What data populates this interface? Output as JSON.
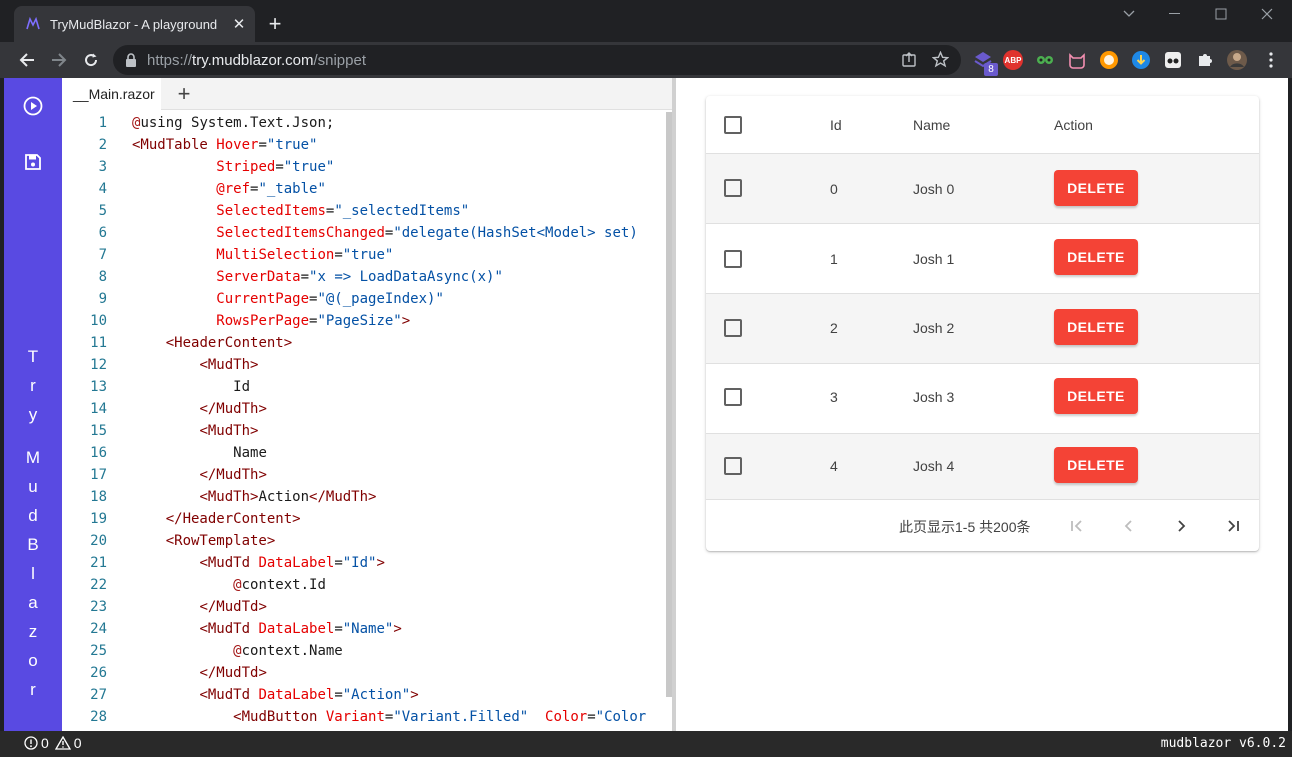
{
  "browser": {
    "tab_title": "TryMudBlazor - A playground",
    "url_scheme": "https://",
    "url_host": "try.mudblazor.com",
    "url_path": "/snippet",
    "extension_badge": "8",
    "abp_label": "ABP"
  },
  "editor": {
    "tab_label": "__Main.razor",
    "lines": [
      {
        "n": "1",
        "parts": [
          [
            "az",
            "@"
          ],
          [
            "",
            "using System.Text.Json;"
          ]
        ]
      },
      {
        "n": "2",
        "parts": [
          [
            "el",
            "<MudTable "
          ],
          [
            "at",
            "Hover"
          ],
          [
            "",
            "="
          ],
          [
            "st",
            "\"true\""
          ]
        ]
      },
      {
        "n": "3",
        "indent": "          ",
        "parts": [
          [
            "at",
            "Striped"
          ],
          [
            "",
            "="
          ],
          [
            "st",
            "\"true\""
          ]
        ]
      },
      {
        "n": "4",
        "indent": "          ",
        "parts": [
          [
            "at",
            "@ref"
          ],
          [
            "",
            "="
          ],
          [
            "st",
            "\"_table\""
          ]
        ]
      },
      {
        "n": "5",
        "indent": "          ",
        "parts": [
          [
            "at",
            "SelectedItems"
          ],
          [
            "",
            "="
          ],
          [
            "st",
            "\"_selectedItems\""
          ]
        ]
      },
      {
        "n": "6",
        "indent": "          ",
        "parts": [
          [
            "at",
            "SelectedItemsChanged"
          ],
          [
            "",
            "="
          ],
          [
            "st",
            "\"delegate(HashSet<Model> set)"
          ]
        ]
      },
      {
        "n": "7",
        "indent": "          ",
        "parts": [
          [
            "at",
            "MultiSelection"
          ],
          [
            "",
            "="
          ],
          [
            "st",
            "\"true\""
          ]
        ]
      },
      {
        "n": "8",
        "indent": "          ",
        "parts": [
          [
            "at",
            "ServerData"
          ],
          [
            "",
            "="
          ],
          [
            "st",
            "\"x => LoadDataAsync(x)\""
          ]
        ]
      },
      {
        "n": "9",
        "indent": "          ",
        "parts": [
          [
            "at",
            "CurrentPage"
          ],
          [
            "",
            "="
          ],
          [
            "st",
            "\"@(_pageIndex)\""
          ]
        ]
      },
      {
        "n": "10",
        "indent": "          ",
        "parts": [
          [
            "at",
            "RowsPerPage"
          ],
          [
            "",
            "="
          ],
          [
            "st",
            "\"PageSize\""
          ],
          [
            "el",
            ">"
          ]
        ]
      },
      {
        "n": "11",
        "indent": "    ",
        "parts": [
          [
            "el",
            "<"
          ],
          [
            "el",
            "HeaderContent"
          ],
          [
            "el",
            ">"
          ]
        ]
      },
      {
        "n": "12",
        "indent": "        ",
        "parts": [
          [
            "el",
            "<MudTh>"
          ]
        ]
      },
      {
        "n": "13",
        "indent": "            ",
        "parts": [
          [
            "",
            "Id"
          ]
        ]
      },
      {
        "n": "14",
        "indent": "        ",
        "parts": [
          [
            "el",
            "</MudTh>"
          ]
        ]
      },
      {
        "n": "15",
        "indent": "        ",
        "parts": [
          [
            "el",
            "<MudTh>"
          ]
        ]
      },
      {
        "n": "16",
        "indent": "            ",
        "parts": [
          [
            "",
            "Name"
          ]
        ]
      },
      {
        "n": "17",
        "indent": "        ",
        "parts": [
          [
            "el",
            "</MudTh>"
          ]
        ]
      },
      {
        "n": "18",
        "indent": "        ",
        "parts": [
          [
            "el",
            "<MudTh>"
          ],
          [
            "",
            "Action"
          ],
          [
            "el",
            "</MudTh>"
          ]
        ]
      },
      {
        "n": "19",
        "indent": "    ",
        "parts": [
          [
            "el",
            "</HeaderContent>"
          ]
        ]
      },
      {
        "n": "20",
        "indent": "    ",
        "parts": [
          [
            "el",
            "<RowTemplate>"
          ]
        ]
      },
      {
        "n": "21",
        "indent": "        ",
        "parts": [
          [
            "el",
            "<MudTd "
          ],
          [
            "at",
            "DataLabel"
          ],
          [
            "",
            "="
          ],
          [
            "st",
            "\"Id\""
          ],
          [
            "el",
            ">"
          ]
        ]
      },
      {
        "n": "22",
        "indent": "            ",
        "parts": [
          [
            "az",
            "@"
          ],
          [
            "",
            "context.Id"
          ]
        ]
      },
      {
        "n": "23",
        "indent": "        ",
        "parts": [
          [
            "el",
            "</MudTd>"
          ]
        ]
      },
      {
        "n": "24",
        "indent": "        ",
        "parts": [
          [
            "el",
            "<MudTd "
          ],
          [
            "at",
            "DataLabel"
          ],
          [
            "",
            "="
          ],
          [
            "st",
            "\"Name\""
          ],
          [
            "el",
            ">"
          ]
        ]
      },
      {
        "n": "25",
        "indent": "            ",
        "parts": [
          [
            "az",
            "@"
          ],
          [
            "",
            "context.Name"
          ]
        ]
      },
      {
        "n": "26",
        "indent": "        ",
        "parts": [
          [
            "el",
            "</MudTd>"
          ]
        ]
      },
      {
        "n": "27",
        "indent": "        ",
        "parts": [
          [
            "el",
            "<MudTd "
          ],
          [
            "at",
            "DataLabel"
          ],
          [
            "",
            "="
          ],
          [
            "st",
            "\"Action\""
          ],
          [
            "el",
            ">"
          ]
        ]
      },
      {
        "n": "28",
        "indent": "            ",
        "parts": [
          [
            "el",
            "<MudButton "
          ],
          [
            "at",
            "Variant"
          ],
          [
            "",
            "="
          ],
          [
            "st",
            "\"Variant.Filled\""
          ],
          [
            "",
            "  "
          ],
          [
            "at",
            "Color"
          ],
          [
            "",
            "="
          ],
          [
            "st",
            "\"Color"
          ]
        ]
      }
    ]
  },
  "sidebar": {
    "vertical_text": [
      "T",
      "r",
      "y",
      "",
      "M",
      "u",
      "d",
      "B",
      "l",
      "a",
      "z",
      "o",
      "r"
    ]
  },
  "table": {
    "headers": {
      "id": "Id",
      "name": "Name",
      "action": "Action"
    },
    "rows": [
      {
        "id": "0",
        "name": "Josh 0",
        "action": "DELETE"
      },
      {
        "id": "1",
        "name": "Josh 1",
        "action": "DELETE"
      },
      {
        "id": "2",
        "name": "Josh 2",
        "action": "DELETE"
      },
      {
        "id": "3",
        "name": "Josh 3",
        "action": "DELETE"
      },
      {
        "id": "4",
        "name": "Josh 4",
        "action": "DELETE"
      }
    ],
    "pager_info": "此页显示1-5 共200条"
  },
  "status": {
    "errors": "0",
    "warnings": "0",
    "version": "mudblazor v6.0.2"
  },
  "colors": {
    "brand": "#594ae2",
    "error": "#f44336"
  }
}
